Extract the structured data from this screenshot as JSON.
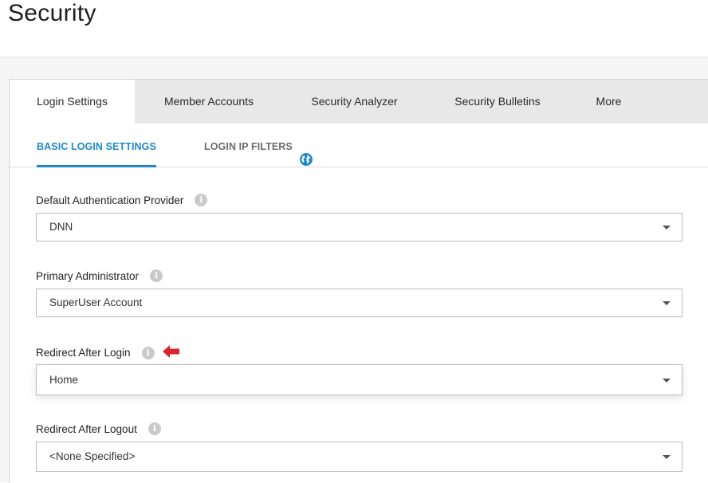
{
  "page": {
    "title": "Security"
  },
  "main_tabs": [
    {
      "label": "Login Settings",
      "active": true
    },
    {
      "label": "Member Accounts",
      "active": false
    },
    {
      "label": "Security Analyzer",
      "active": false
    },
    {
      "label": "Security Bulletins",
      "active": false
    },
    {
      "label": "More",
      "active": false
    }
  ],
  "sub_tabs": [
    {
      "label": "BASIC LOGIN SETTINGS",
      "active": true
    },
    {
      "label": "LOGIN IP FILTERS",
      "active": false,
      "icon": "globe-icon"
    }
  ],
  "fields": [
    {
      "label": "Default Authentication Provider",
      "value": "DNN"
    },
    {
      "label": "Primary Administrator",
      "value": "SuperUser Account"
    },
    {
      "label": "Redirect After Login",
      "value": "Home"
    },
    {
      "label": "Redirect After Logout",
      "value": "<None Specified>"
    }
  ],
  "colors": {
    "accent": "#1e88c7",
    "arrow": "#d9262c"
  }
}
